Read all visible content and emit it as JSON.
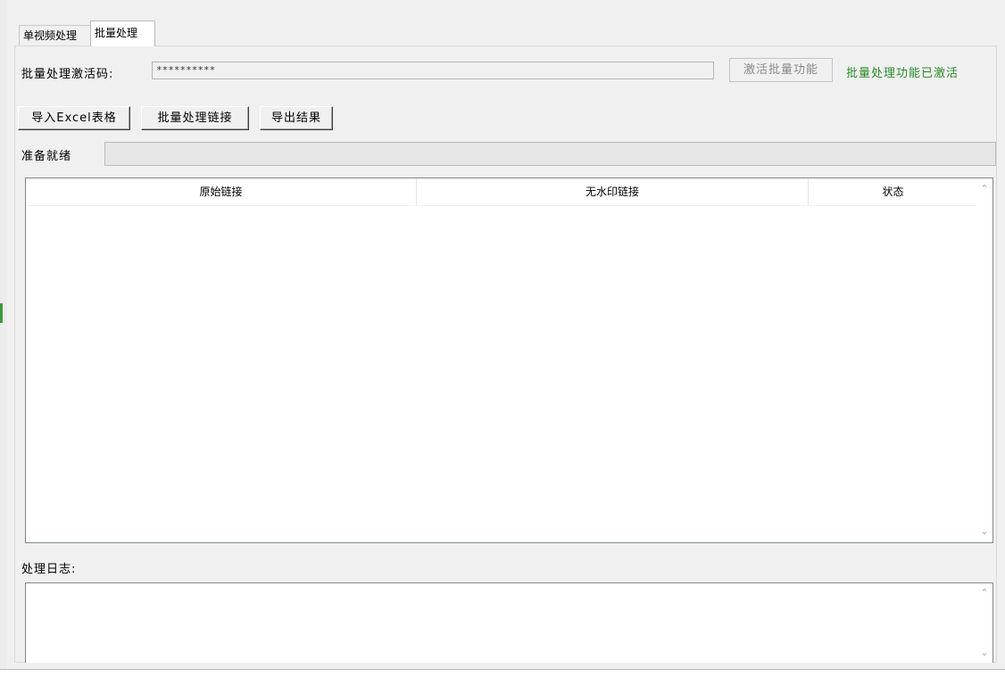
{
  "tabs": [
    {
      "label": "单视频处理",
      "active": false
    },
    {
      "label": "批量处理",
      "active": true
    }
  ],
  "activation": {
    "label": "批量处理激活码:",
    "code_value": "**********",
    "activate_button": "激活批量功能",
    "status_text": "批量处理功能已激活",
    "status_color": "#2a8a2a"
  },
  "toolbar": {
    "import_excel": "导入Excel表格",
    "batch_process": "批量处理链接",
    "export_results": "导出结果"
  },
  "progress": {
    "label": "准备就绪",
    "value_percent": 0
  },
  "results_table": {
    "columns": [
      "原始链接",
      "无水印链接",
      "状态"
    ],
    "rows": []
  },
  "log": {
    "label": "处理日志:",
    "content": ""
  },
  "icons": {
    "scroll_up": "chevron-up-icon",
    "scroll_down": "chevron-down-icon"
  }
}
